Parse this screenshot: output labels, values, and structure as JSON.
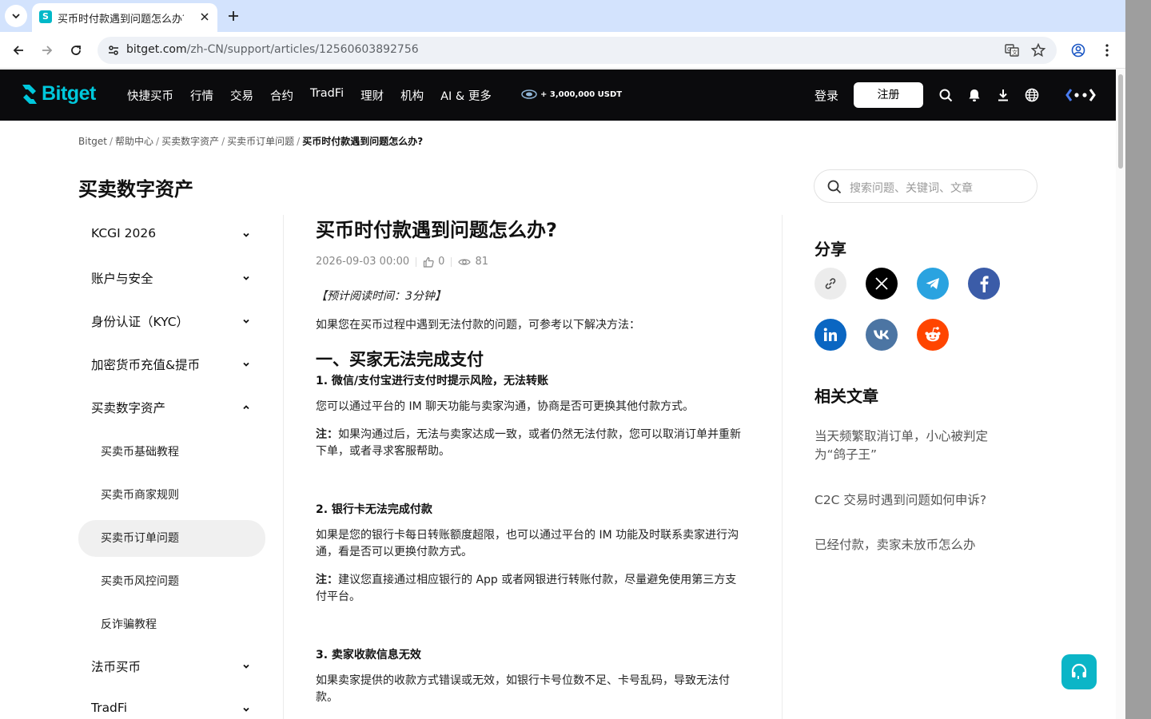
{
  "browser": {
    "tab_title": "买币时付款遇到问题怎么办？",
    "url_host": "bitget.com",
    "url_path": "/zh-CN/support/articles/12560603892756"
  },
  "header": {
    "logo": "Bitget",
    "nav": [
      "快捷买币",
      "行情",
      "交易",
      "合约",
      "TradFi",
      "理财",
      "机构",
      "AI & 更多"
    ],
    "promo": "+ 3,000,000 USDT",
    "login": "登录",
    "register": "注册"
  },
  "breadcrumb": [
    "Bitget",
    "帮助中心",
    "买卖数字资产",
    "买卖币订单问题",
    "买币时付款遇到问题怎么办?"
  ],
  "section_title": "买卖数字资产",
  "sidebar": {
    "items": [
      {
        "label": "KCGI 2026"
      },
      {
        "label": "账户与安全"
      },
      {
        "label": "身份认证（KYC）"
      },
      {
        "label": "加密货币充值&提币"
      },
      {
        "label": "买卖数字资产"
      }
    ],
    "subitems": [
      {
        "label": "买卖币基础教程"
      },
      {
        "label": "买卖币商家规则"
      },
      {
        "label": "买卖币订单问题"
      },
      {
        "label": "买卖币风控问题"
      },
      {
        "label": "反诈骗教程"
      }
    ],
    "after": [
      {
        "label": "法币买币"
      },
      {
        "label": "TradFi"
      }
    ]
  },
  "article": {
    "title": "买币时付款遇到问题怎么办?",
    "date": "2026-09-03 00:00",
    "likes": "0",
    "views": "81",
    "read_time": "【预计阅读时间：3分钟】",
    "intro": "如果您在买币过程中遇到无法付款的问题，可参考以下解决方法：",
    "h_section1": "一、买家无法完成支付",
    "h1": "1. 微信/支付宝进行支付时提示风险，无法转账",
    "p1": "您可以通过平台的 IM 聊天功能与卖家沟通，协商是否可更换其他付款方式。",
    "note_label": "注：",
    "p1_note": "如果沟通过后，无法与卖家达成一致，或者仍然无法付款，您可以取消订单并重新下单，或者寻求客服帮助。",
    "h2": "2. 银行卡无法完成付款",
    "p2": "如果是您的银行卡每日转账额度超限，也可以通过平台的 IM 功能及时联系卖家进行沟通，看是否可以更换付款方式。",
    "p2_note": "建议您直接通过相应银行的 App 或者网银进行转账付款，尽量避免使用第三方支付平台。",
    "h3": "3. 卖家收款信息无效",
    "p3": "如果卖家提供的收款方式错误或无效，如银行卡号位数不足、卡号乱码，导致无法付款。"
  },
  "search": {
    "placeholder": "搜索问题、关键词、文章"
  },
  "share": {
    "title": "分享"
  },
  "related": {
    "title": "相关文章",
    "links": [
      "当天频繁取消订单，小心被判定为“鸽子王”",
      "C2C 交易时遇到问题如何申诉?",
      "已经付款，卖家未放币怎么办"
    ]
  },
  "colors": {
    "brand": "#00c8dc",
    "header_bg": "#0b0b0d"
  }
}
